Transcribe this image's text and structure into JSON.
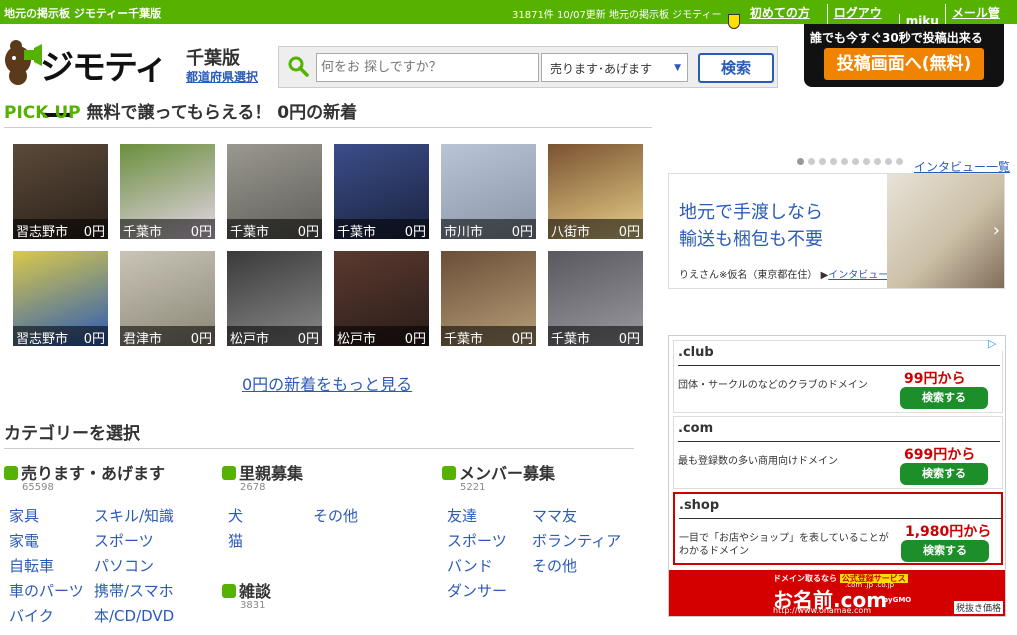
{
  "topbar": {
    "site_label": "地元の掲示板 ジモティー千葉版",
    "meta": "31871件 10/07更新 地元の掲示板 ジモティー",
    "links": [
      "初めての方へ",
      "ログアウト",
      "miku",
      "メール管理"
    ]
  },
  "header": {
    "logo_text": "ジモティー",
    "prefecture": "千葉版",
    "prefecture_select": "都道府県選択"
  },
  "search": {
    "placeholder": "何をお 探しですか？",
    "category": "売ります･あげます",
    "button": "検索"
  },
  "post_promo": {
    "tagline": "誰でも今すぐ30秒で投稿出来る",
    "button": "投稿画面へ(無料)"
  },
  "pickup": {
    "tag": "PICK UP",
    "title": "無料で譲ってもらえる！ 0円の新着",
    "items": [
      {
        "city": "習志野市",
        "price": "0円",
        "c1": "#5a4a3a",
        "c2": "#2b2018"
      },
      {
        "city": "千葉市",
        "price": "0円",
        "c1": "#6a8f3c",
        "c2": "#e6d6e8"
      },
      {
        "city": "千葉市",
        "price": "0円",
        "c1": "#9a9890",
        "c2": "#5f5e58"
      },
      {
        "city": "千葉市",
        "price": "0円",
        "c1": "#3b4e8a",
        "c2": "#1a223d"
      },
      {
        "city": "市川市",
        "price": "0円",
        "c1": "#b9c4d6",
        "c2": "#8a95a8"
      },
      {
        "city": "八街市",
        "price": "0円",
        "c1": "#7a5230",
        "c2": "#e8cf8a"
      },
      {
        "city": "習志野市",
        "price": "0円",
        "c1": "#d9c94a",
        "c2": "#2a5ab8"
      },
      {
        "city": "君津市",
        "price": "0円",
        "c1": "#c9c4b6",
        "c2": "#8b8676"
      },
      {
        "city": "松戸市",
        "price": "0円",
        "c1": "#3a3a3a",
        "c2": "#8a8a8a"
      },
      {
        "city": "松戸市",
        "price": "0円",
        "c1": "#5a3a30",
        "c2": "#2a1c18"
      },
      {
        "city": "千葉市",
        "price": "0円",
        "c1": "#6a4e38",
        "c2": "#b8a078"
      },
      {
        "city": "千葉市",
        "price": "0円",
        "c1": "#58585e",
        "c2": "#9a9aa0"
      }
    ],
    "more": "0円の新着をもっと見る"
  },
  "categories": {
    "title": "カテゴリーを選択",
    "groups": [
      {
        "name": "売ります・あげます",
        "count": "65598",
        "links": [
          "家具",
          "スキル/知識",
          "家電",
          "スポーツ",
          "自転車",
          "パソコン",
          "車のパーツ",
          "携帯/スマホ",
          "バイク",
          "本/CD/DVD"
        ]
      },
      {
        "name": "里親募集",
        "count": "2678",
        "links": [
          "犬",
          "その他",
          "猫"
        ]
      },
      {
        "name": "メンバー募集",
        "count": "5221",
        "links": [
          "友達",
          "ママ友",
          "スポーツ",
          "ボランティア",
          "バンド",
          "その他",
          "ダンサー"
        ]
      },
      {
        "name": "雑談",
        "count": "3831",
        "links": []
      }
    ]
  },
  "interview": {
    "link": "インタビュー一覧",
    "line1": "地元で手渡しなら",
    "line2": "輸送も梱包も不要",
    "credit": "りえさん※仮名（東京都在住）",
    "credit_link": "インタビュー"
  },
  "ad": {
    "blocks": [
      {
        "domain": ".club",
        "desc": "団体・サークルのなどのクラブのドメイン",
        "price": "99円から",
        "btn": "検索する"
      },
      {
        "domain": ".com",
        "desc": "最も登録数の多い商用向けドメイン",
        "price": "699円から",
        "btn": "検索する"
      },
      {
        "domain": ".shop",
        "desc": "一目で「お店やショップ」を表していることがわかるドメイン",
        "price": "1,980円から",
        "btn": "検索する"
      }
    ],
    "onamae_top": "ドメイン取るなら",
    "onamae_badge": "公式登録サービス",
    "onamae_logo": "お名前.com",
    "onamae_url": "http://www.onamae.com",
    "onamae_tag": "税抜き価格",
    "onamae_tlds": ".com .jp .co.jp",
    "onamae_gmo": "byGMO"
  }
}
